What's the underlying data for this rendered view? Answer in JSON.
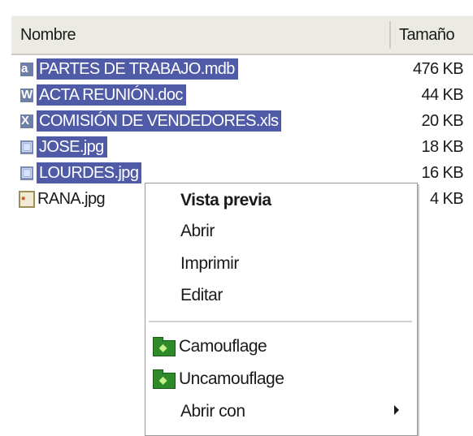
{
  "header": {
    "name_label": "Nombre",
    "size_label": "Tamaño"
  },
  "files": [
    {
      "name": "PARTES DE TRABAJO.mdb",
      "size": "476 KB",
      "selected": true,
      "icon": "access-db-icon"
    },
    {
      "name": "ACTA REUNIÓN.doc",
      "size": "44 KB",
      "selected": true,
      "icon": "word-doc-icon"
    },
    {
      "name": "COMISIÓN DE VENDEDORES.xls",
      "size": "20 KB",
      "selected": true,
      "icon": "excel-xls-icon"
    },
    {
      "name": "JOSE.jpg",
      "size": "18 KB",
      "selected": true,
      "icon": "jpg-image-icon"
    },
    {
      "name": "LOURDES.jpg",
      "size": "16 KB",
      "selected": true,
      "icon": "jpg-image-icon"
    },
    {
      "name": "RANA.jpg",
      "size": "4 KB",
      "selected": false,
      "icon": "jpg-image-icon"
    }
  ],
  "menu": {
    "preview": "Vista previa",
    "open": "Abrir",
    "print": "Imprimir",
    "edit": "Editar",
    "camouflage": "Camouflage",
    "uncamouflage": "Uncamouflage",
    "open_with": "Abrir con"
  },
  "colors": {
    "selection": "#4f5ba6",
    "header_bg": "#ebeae3",
    "menu_icon_green": "#2f8a2a"
  }
}
